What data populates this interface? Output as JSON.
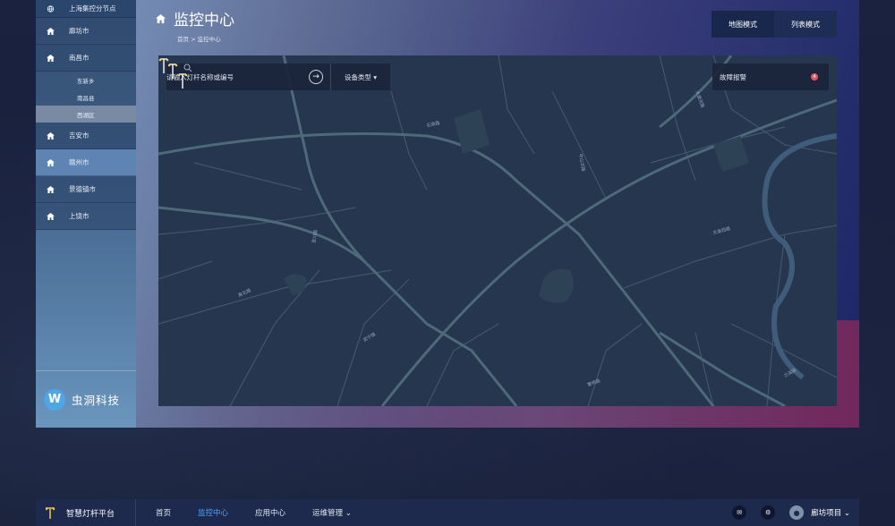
{
  "sidebar": {
    "items": [
      {
        "label": "上海集控分节点",
        "icon": "globe-icon"
      },
      {
        "label": "廊坊市",
        "icon": "home-icon"
      },
      {
        "label": "南昌市",
        "icon": "home-icon"
      },
      {
        "label": "吉安市",
        "icon": "home-icon"
      },
      {
        "label": "赣州市",
        "icon": "home-icon"
      },
      {
        "label": "景德镇市",
        "icon": "home-icon"
      },
      {
        "label": "上饶市",
        "icon": "home-icon"
      }
    ],
    "sub_items": [
      "东新乡",
      "南昌县",
      "西湖区"
    ],
    "brand": "虫洞科技"
  },
  "header": {
    "title": "监控中心",
    "breadcrumb": "首页 > 监控中心",
    "modes": [
      "地图模式",
      "列表模式"
    ]
  },
  "map": {
    "search_placeholder": "请输入灯杆名称或编号",
    "device_type": "设备类型 ▾",
    "alarm_label": "故障报警",
    "alarm_count": "4",
    "street_labels": [
      "石泉路",
      "中山北路",
      "大渡河路",
      "宜川路",
      "光复西路",
      "真北路",
      "曹杨路",
      "武宁路",
      "兰溪路"
    ]
  },
  "footer": {
    "platform": "智慧灯杆平台",
    "nav": [
      "首页",
      "监控中心",
      "应用中心",
      "运维管理 ⌄"
    ],
    "project": "廊坊项目 ⌄"
  },
  "colors": {
    "accent": "#4da3ff",
    "alarm": "#e0575e",
    "map_bg": "#26364f",
    "road": "#4e6a79"
  }
}
